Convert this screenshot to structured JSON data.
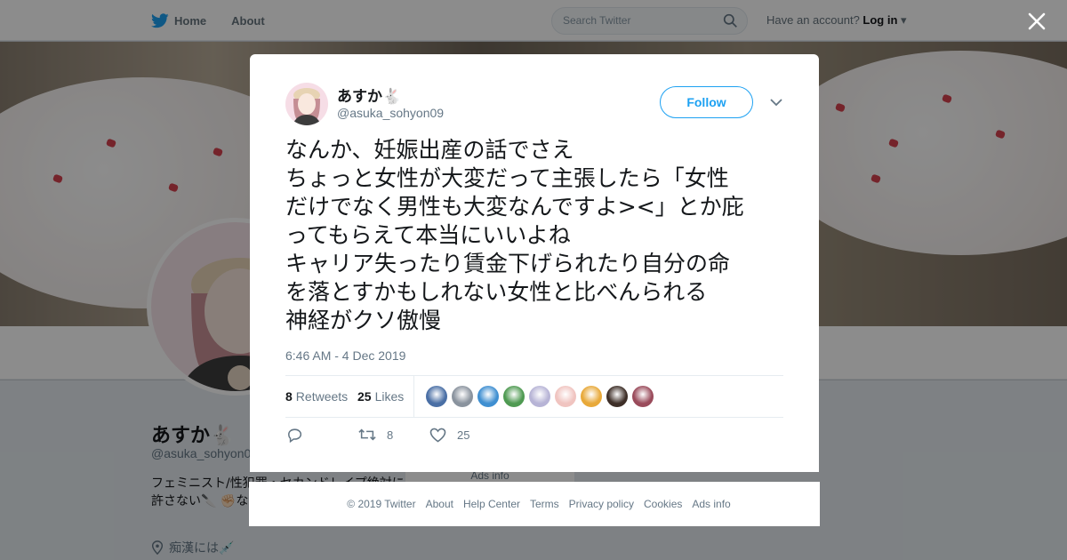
{
  "topbar": {
    "home_label": "Home",
    "about_label": "About",
    "search_placeholder": "Search Twitter",
    "account_prompt": "Have an account?",
    "login_label": "Log in"
  },
  "background_profile": {
    "name": "あすか🐇",
    "handle": "@asuka_sohyon09",
    "bio": "フェミニスト/性犯罪・セカンドレイプ絶対に許さない🔪 ✊🏻な✋🏻",
    "location": "痴漢には💉",
    "ads_info": "Ads info"
  },
  "tweet": {
    "name": "あすか🐇",
    "handle": "@asuka_sohyon09",
    "follow_label": "Follow",
    "lines": [
      "なんか、妊娠出産の話でさえ",
      "ちょっと女性が大変だって主張したら「女性",
      "だけでなく男性も大変なんですよ><」とか庇",
      "ってもらえて本当にいいよね",
      "キャリア失ったり賃金下げられたり自分の命",
      "を落とすかもしれない女性と比べんられる",
      "神経がクソ傲慢"
    ],
    "timestamp": "6:46 AM - 4 Dec 2019",
    "retweets_count": "8",
    "retweets_label": "Retweets",
    "likes_count": "25",
    "likes_label": "Likes",
    "liker_colors": [
      "#4a6fa5",
      "#8a939e",
      "#3f8fd1",
      "#4f9a52",
      "#b7b4d6",
      "#f0c4c0",
      "#e8a93a",
      "#3e2f28",
      "#9a4b5b"
    ],
    "action_retweet_count": "8",
    "action_like_count": "25"
  },
  "footer": {
    "links": [
      "© 2019 Twitter",
      "About",
      "Help Center",
      "Terms",
      "Privacy policy",
      "Cookies",
      "Ads info"
    ]
  },
  "colors": {
    "brand_blue": "#1da1f2",
    "text_dark": "#14171a",
    "text_muted": "#657786"
  }
}
